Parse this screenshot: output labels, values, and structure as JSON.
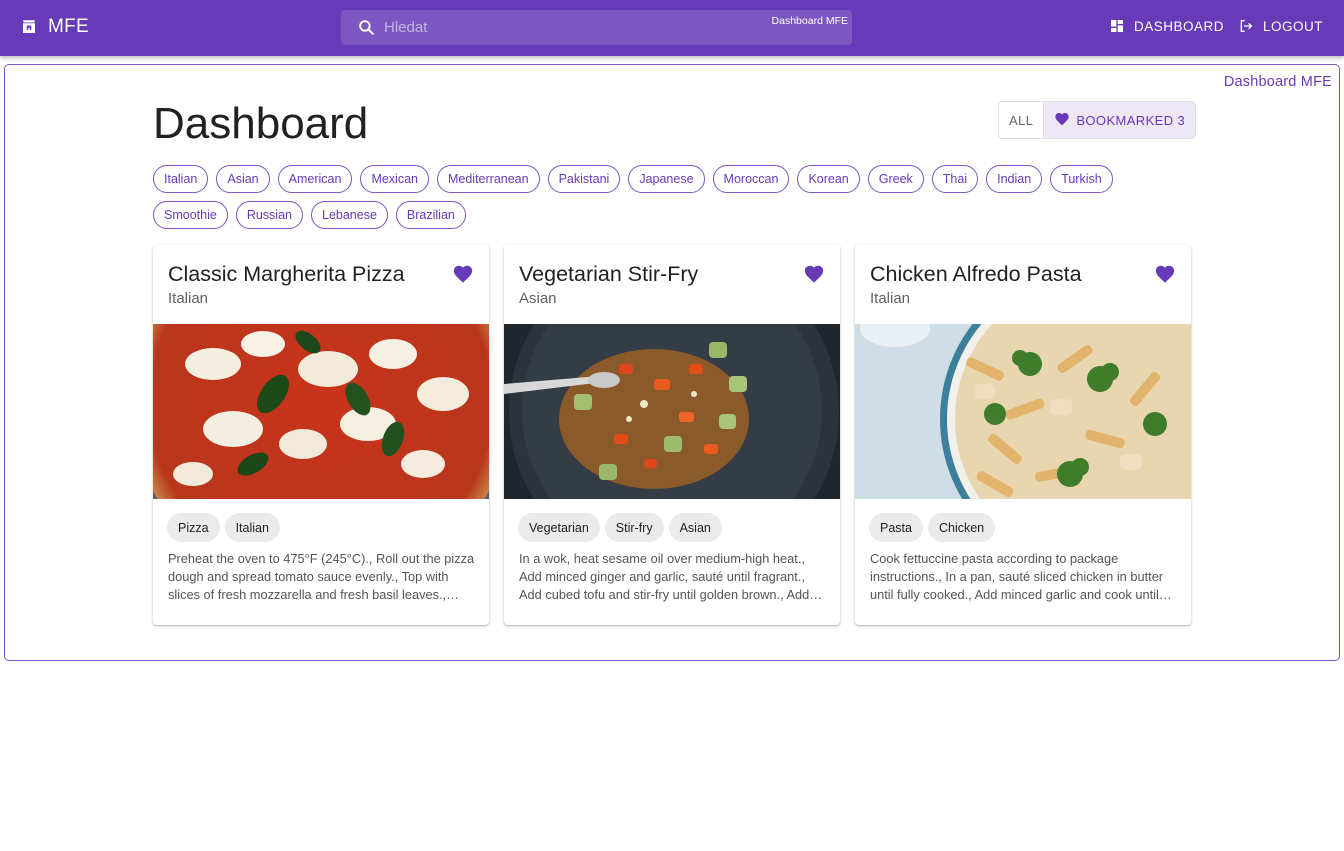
{
  "header": {
    "brand": "MFE",
    "search_placeholder": "Hledat",
    "search_tag": "Dashboard MFE",
    "nav": {
      "dashboard": "DASHBOARD",
      "logout": "LOGOUT"
    },
    "icons": [
      "store-icon",
      "search-icon",
      "dashboard-icon",
      "logout-icon"
    ],
    "colors": {
      "primary": "#673ab7"
    }
  },
  "main": {
    "mfe_label": "Dashboard MFE",
    "title": "Dashboard",
    "filter_toggle": {
      "all": "ALL",
      "bookmarked": "BOOKMARKED 3",
      "selected": "bookmarked"
    },
    "categories": [
      "Italian",
      "Asian",
      "American",
      "Mexican",
      "Mediterranean",
      "Pakistani",
      "Japanese",
      "Moroccan",
      "Korean",
      "Greek",
      "Thai",
      "Indian",
      "Turkish",
      "Smoothie",
      "Russian",
      "Lebanese",
      "Brazilian"
    ],
    "recipes": [
      {
        "title": "Classic Margherita Pizza",
        "cuisine": "Italian",
        "bookmarked": true,
        "tags": [
          "Pizza",
          "Italian"
        ],
        "description": "Preheat the oven to 475°F (245°C)., Roll out the pizza dough and spread tomato sauce evenly., Top with slices of fresh mozzarella and fresh basil leaves., Drizzle with olive oil and season with salt and pepper."
      },
      {
        "title": "Vegetarian Stir-Fry",
        "cuisine": "Asian",
        "bookmarked": true,
        "tags": [
          "Vegetarian",
          "Stir-fry",
          "Asian"
        ],
        "description": "In a wok, heat sesame oil over medium-high heat., Add minced ginger and garlic, sauté until fragrant., Add cubed tofu and stir-fry until golden brown., Add broccoli, carrots, and bell peppers."
      },
      {
        "title": "Chicken Alfredo Pasta",
        "cuisine": "Italian",
        "bookmarked": true,
        "tags": [
          "Pasta",
          "Chicken"
        ],
        "description": "Cook fettuccine pasta according to package instructions., In a pan, sauté sliced chicken in butter until fully cooked., Add minced garlic and cook until fragrant., Pour in heavy cream and grated Parmesan cheese."
      }
    ]
  }
}
